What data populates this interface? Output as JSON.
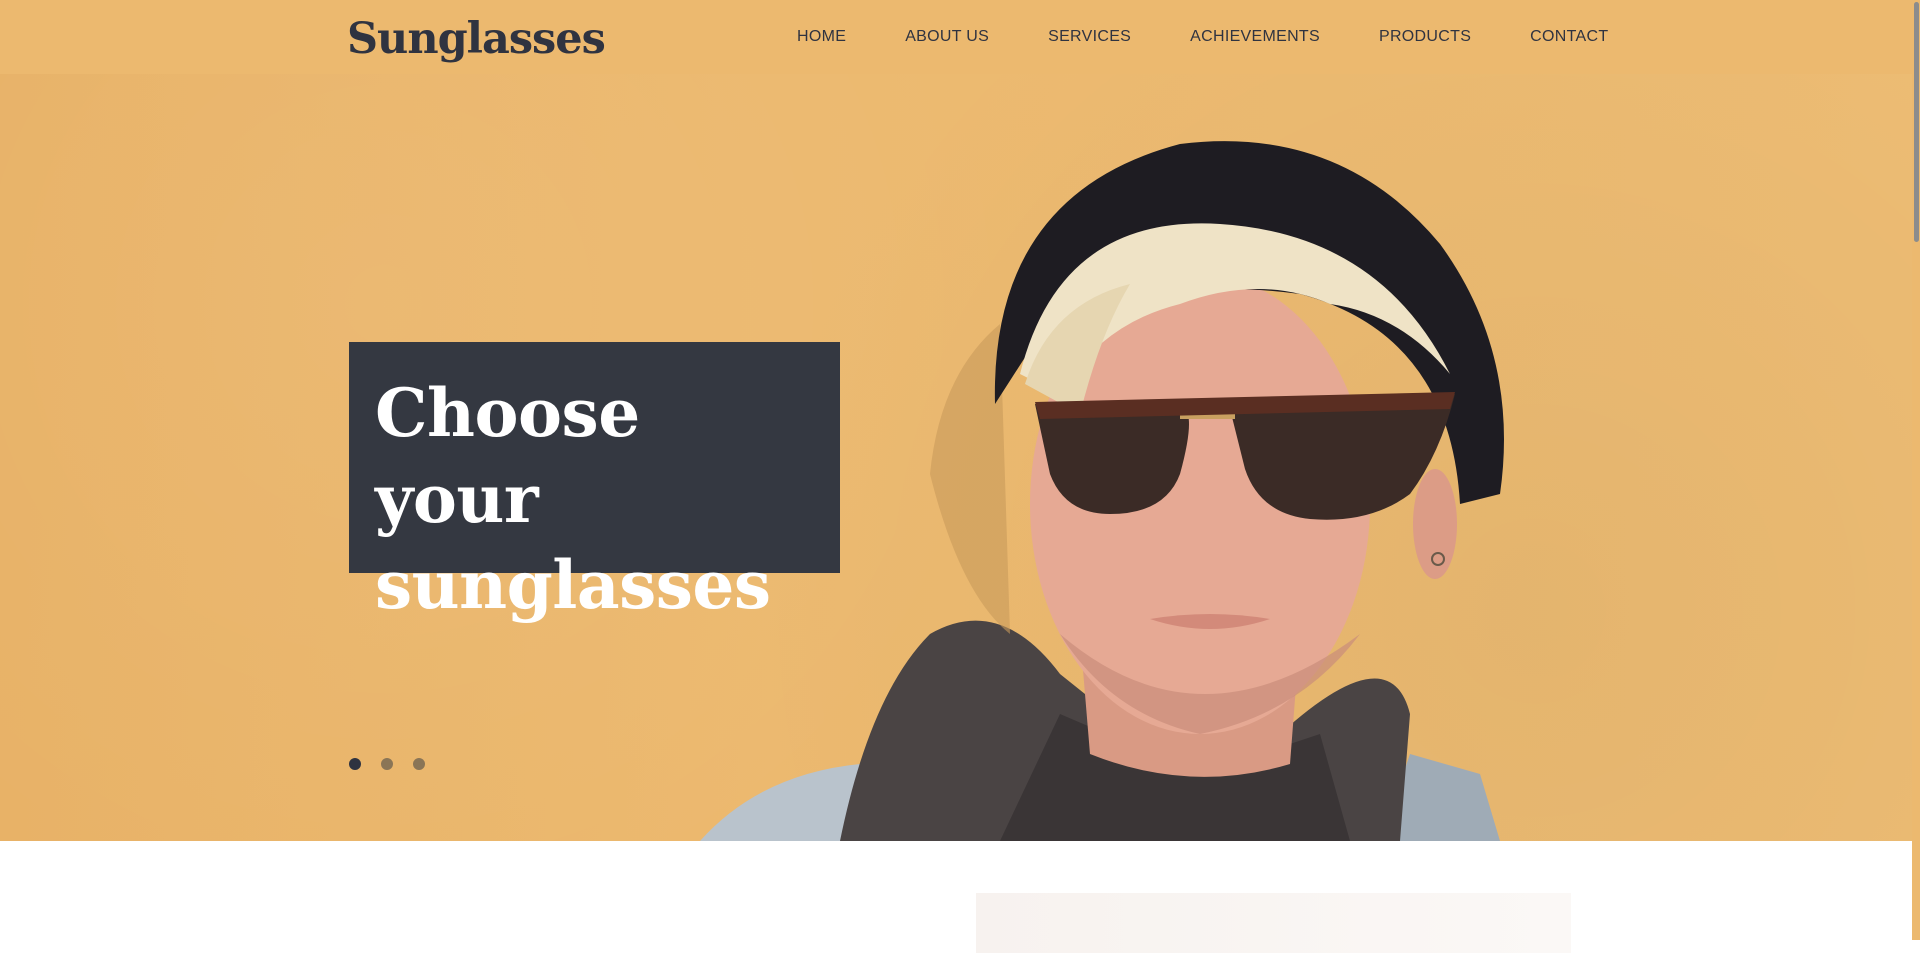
{
  "header": {
    "logo": "Sunglasses",
    "nav": [
      {
        "label": "HOME"
      },
      {
        "label": "ABOUT US"
      },
      {
        "label": "SERVICES"
      },
      {
        "label": "ACHIEVEMENTS"
      },
      {
        "label": "PRODUCTS"
      },
      {
        "label": "CONTACT"
      }
    ]
  },
  "hero": {
    "headline_line1": "Choose your",
    "headline_line2": "sunglasses",
    "slides": {
      "count": 3,
      "active_index": 0
    }
  },
  "colors": {
    "header_bg": "#ecb96f",
    "text_dark": "#2f3340",
    "headline_box": "#343841",
    "headline_text": "#ffffff",
    "dot_inactive": "#8a7556"
  }
}
